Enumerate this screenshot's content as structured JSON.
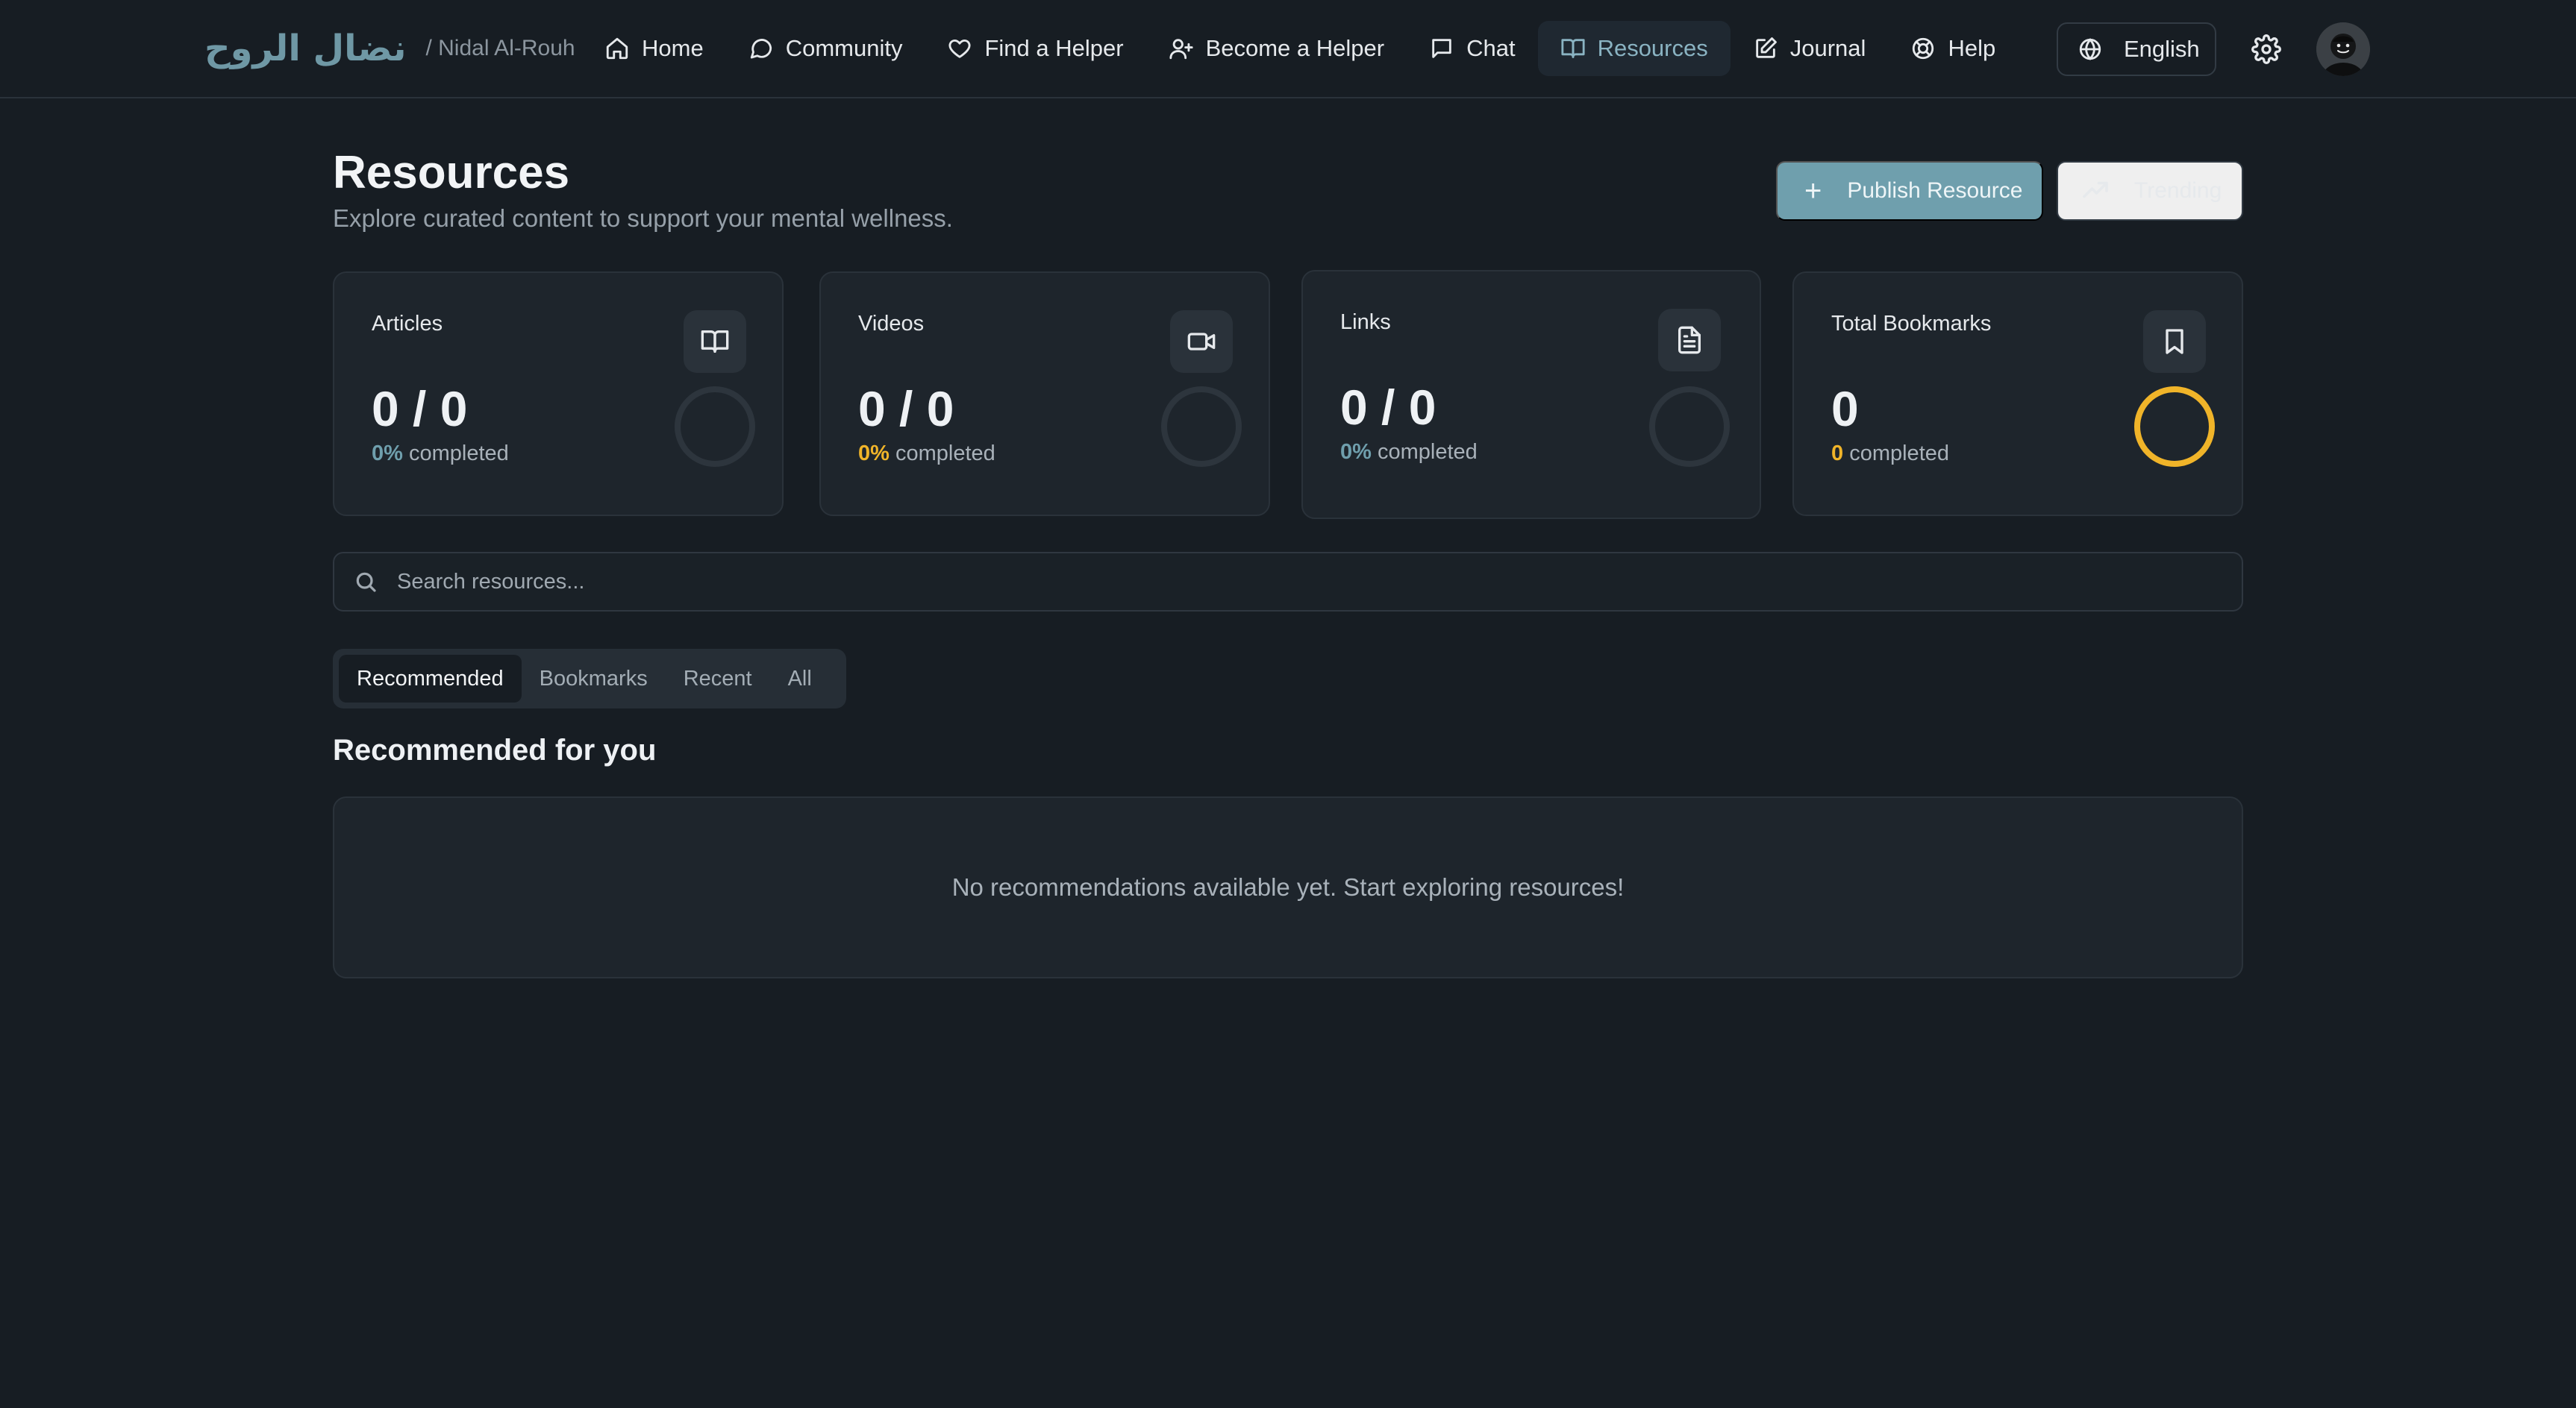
{
  "brand": {
    "arabic": "نضال الروح",
    "english": "/ Nidal Al-Rouh"
  },
  "nav": [
    {
      "label": "Home",
      "icon": "home-icon"
    },
    {
      "label": "Community",
      "icon": "chat-bubble-icon"
    },
    {
      "label": "Find a Helper",
      "icon": "heart-icon"
    },
    {
      "label": "Become a Helper",
      "icon": "user-plus-icon"
    },
    {
      "label": "Chat",
      "icon": "message-square-icon"
    },
    {
      "label": "Resources",
      "icon": "book-open-icon",
      "active": true
    },
    {
      "label": "Journal",
      "icon": "edit-icon"
    },
    {
      "label": "Help",
      "icon": "life-buoy-icon"
    }
  ],
  "language": {
    "label": "English",
    "icon": "globe-icon"
  },
  "header": {
    "title": "Resources",
    "subtitle": "Explore curated content to support your mental wellness.",
    "publish_label": "Publish Resource",
    "trending_label": "Trending"
  },
  "stats": [
    {
      "label": "Articles",
      "value": "0 / 0",
      "pct": "0%",
      "suffix": "completed",
      "accent": "#6f9fad",
      "progress": 0,
      "icon": "book-icon"
    },
    {
      "label": "Videos",
      "value": "0 / 0",
      "pct": "0%",
      "suffix": "completed",
      "accent": "#f0b429",
      "progress": 0,
      "icon": "video-icon"
    },
    {
      "label": "Links",
      "value": "0 / 0",
      "pct": "0%",
      "suffix": "completed",
      "accent": "#6f9fad",
      "progress": 0,
      "icon": "file-text-icon"
    },
    {
      "label": "Total Bookmarks",
      "value": "0",
      "pct": "0",
      "suffix": "completed",
      "accent": "#f0b429",
      "progress": 1,
      "icon": "bookmark-icon"
    }
  ],
  "search": {
    "placeholder": "Search resources..."
  },
  "tabs": [
    {
      "label": "Recommended",
      "active": true
    },
    {
      "label": "Bookmarks"
    },
    {
      "label": "Recent"
    },
    {
      "label": "All"
    }
  ],
  "section": {
    "title": "Recommended for you",
    "empty_text": "No recommendations available yet. Start exploring resources!"
  },
  "colors": {
    "background": "#171d23",
    "card": "#1e252c",
    "accent_teal": "#6f9fad",
    "accent_amber": "#f0b429"
  }
}
